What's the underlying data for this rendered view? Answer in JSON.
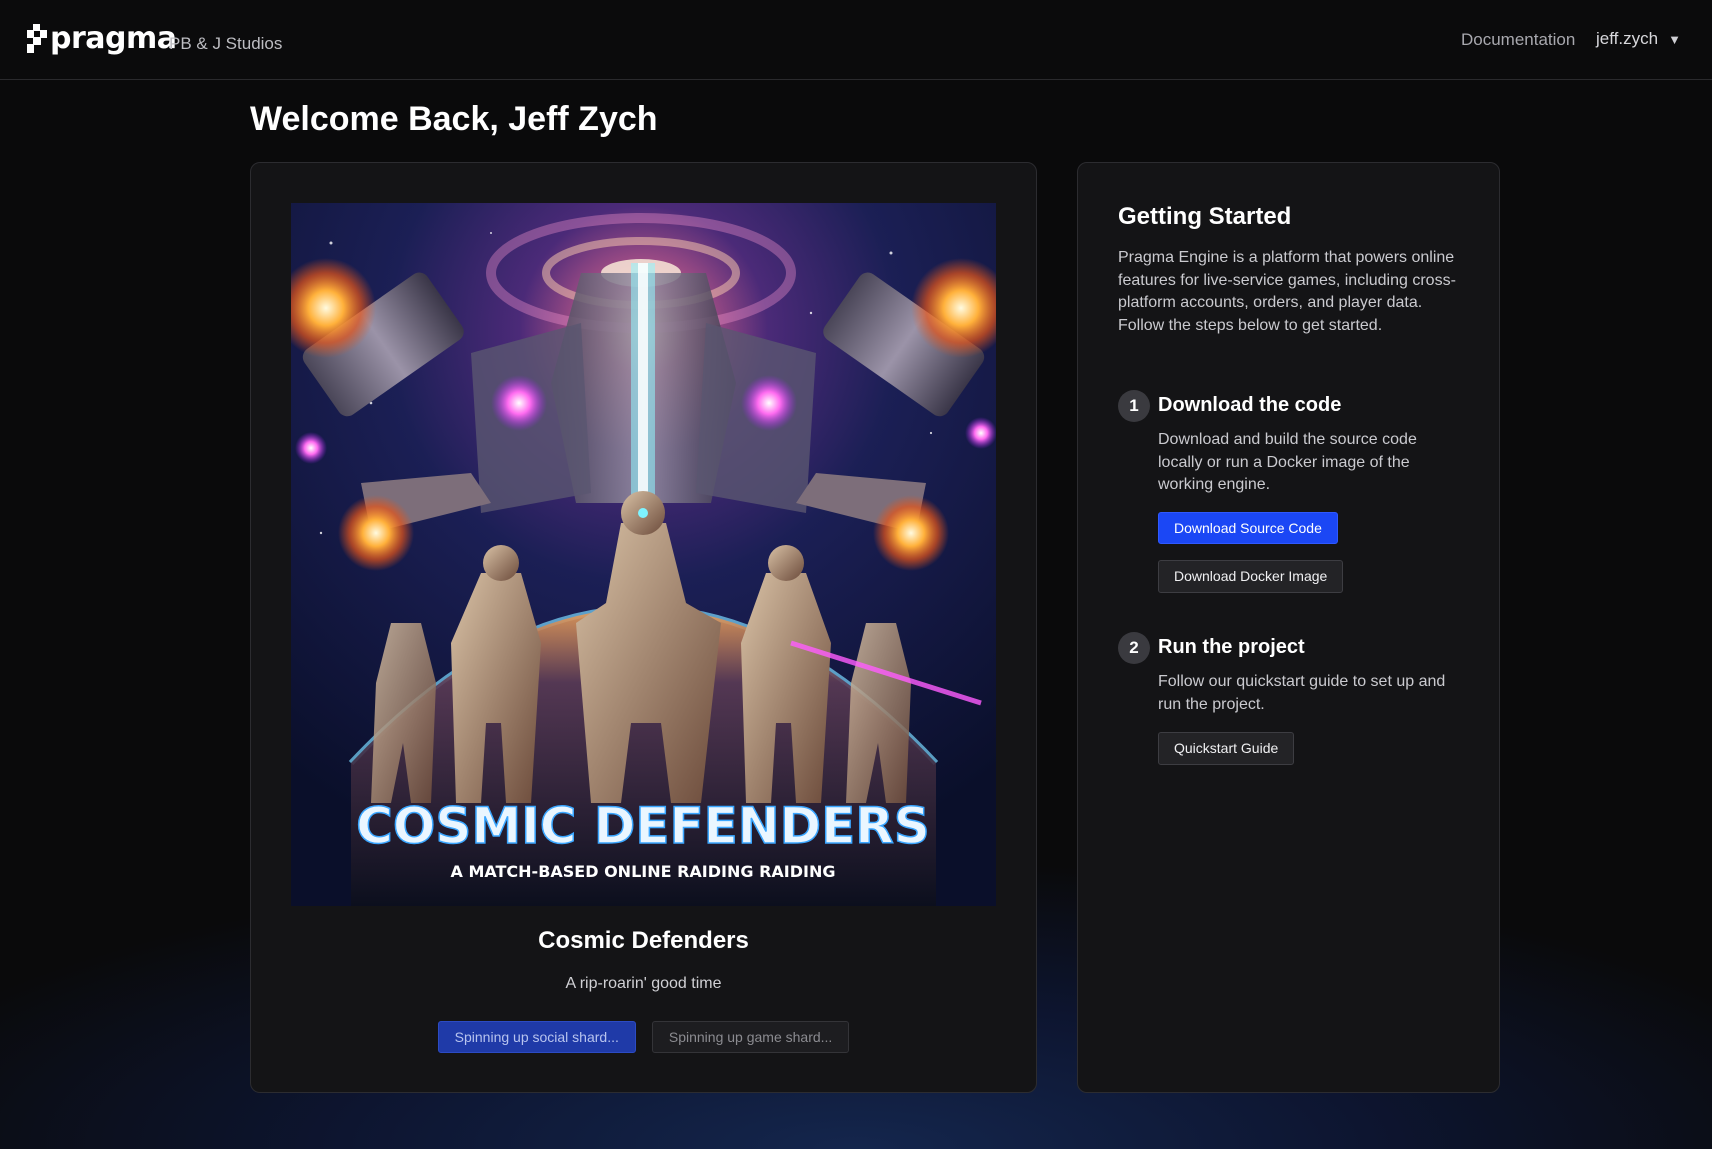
{
  "header": {
    "brand": "pragma",
    "studio": "PB & J Studios",
    "nav_docs": "Documentation",
    "username": "jeff.zych",
    "caret_icon": "chevron-down-icon"
  },
  "welcome": "Welcome Back, Jeff Zych",
  "game": {
    "title": "Cosmic Defenders",
    "subtitle": "A rip-roarin' good time",
    "cover": {
      "headline": "COSMIC DEFENDERS",
      "tagline": "A MATCH-BASED ONLINE RAIDING RAIDING"
    },
    "social_shard_label": "Spinning up social shard...",
    "game_shard_label": "Spinning up game shard..."
  },
  "getting_started": {
    "title": "Getting Started",
    "description": "Pragma Engine is a platform that powers online features for live-service games, including cross-platform accounts, orders, and player data. Follow the steps below to get started.",
    "steps": [
      {
        "number": "1",
        "title": "Download the code",
        "description": "Download and build the source code locally or run a Docker image of the working engine.",
        "primary_button": "Download Source Code",
        "secondary_button": "Download Docker Image"
      },
      {
        "number": "2",
        "title": "Run the project",
        "description": "Follow our quickstart guide to set up and run the project.",
        "secondary_button": "Quickstart Guide"
      }
    ]
  },
  "colors": {
    "primary_button": "#1b47f5",
    "background": "#0a0a0b",
    "card": "#141416"
  }
}
